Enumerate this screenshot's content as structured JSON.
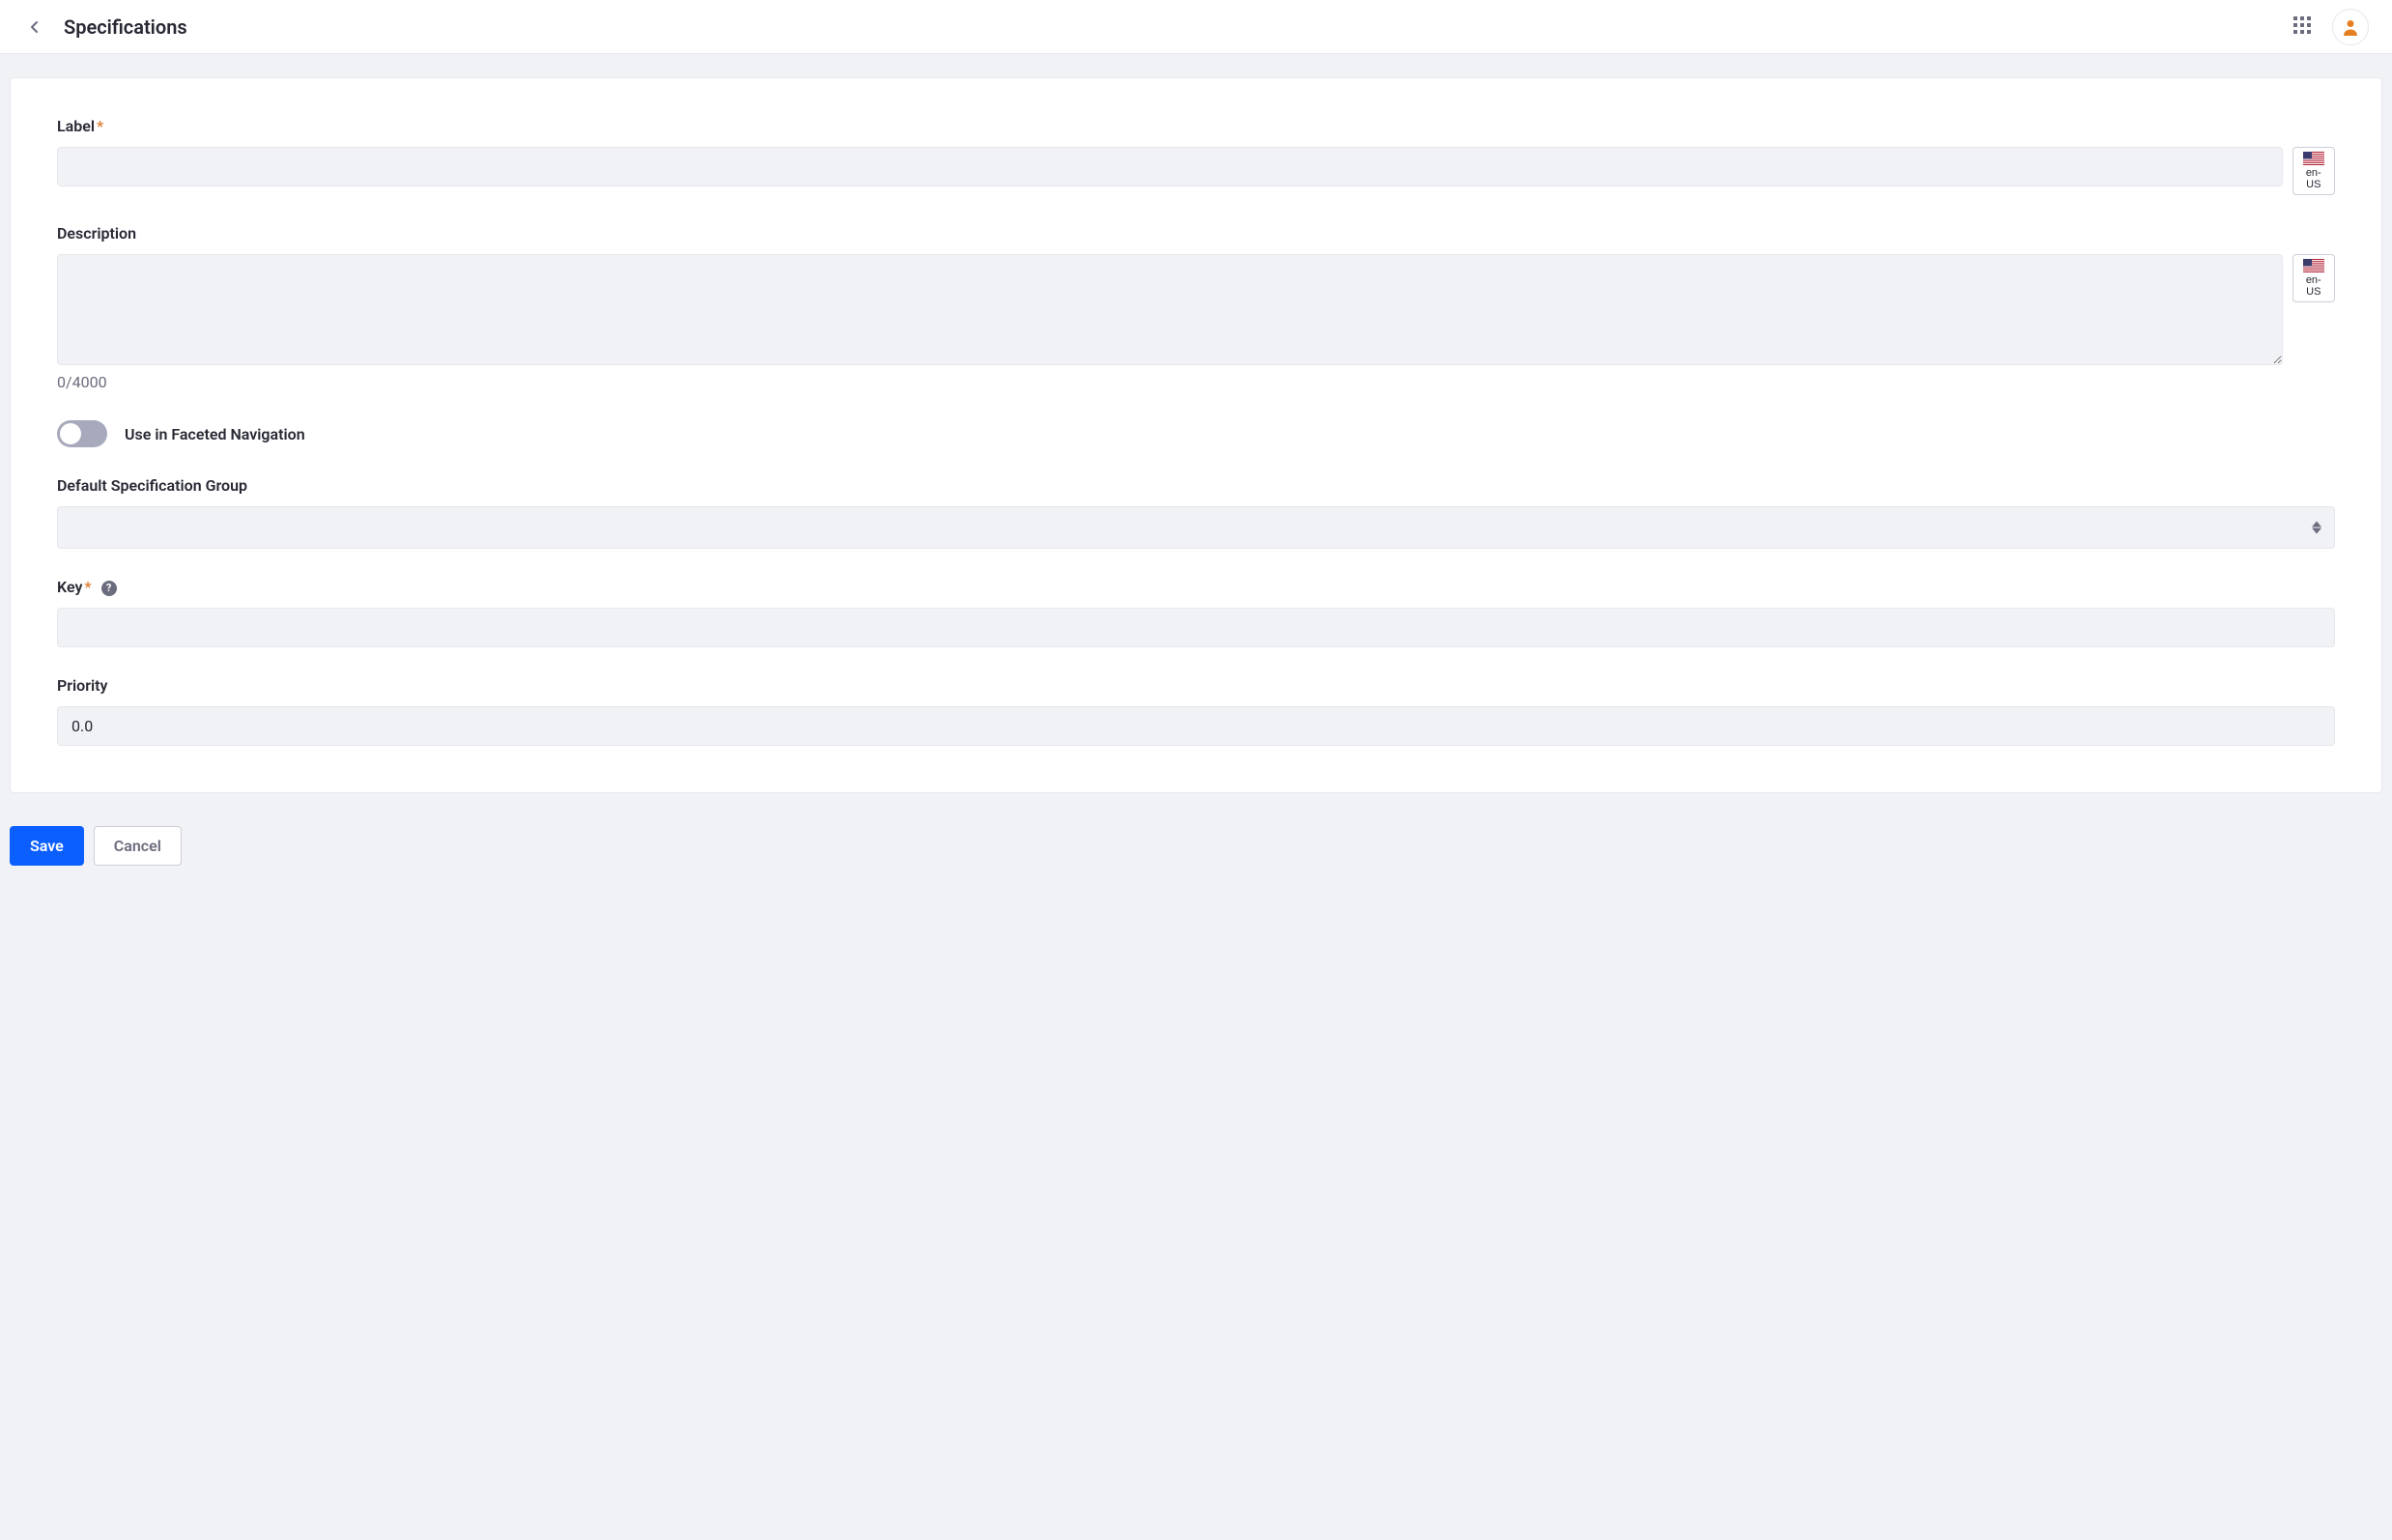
{
  "header": {
    "title": "Specifications"
  },
  "form": {
    "label": {
      "text": "Label",
      "value": "",
      "locale": "en-US"
    },
    "description": {
      "text": "Description",
      "value": "",
      "counter": "0/4000",
      "locale": "en-US"
    },
    "facetedNav": {
      "text": "Use in Faceted Navigation",
      "enabled": false
    },
    "specGroup": {
      "text": "Default Specification Group",
      "value": ""
    },
    "key": {
      "text": "Key",
      "value": ""
    },
    "priority": {
      "text": "Priority",
      "value": "0.0"
    }
  },
  "actions": {
    "save": "Save",
    "cancel": "Cancel"
  }
}
